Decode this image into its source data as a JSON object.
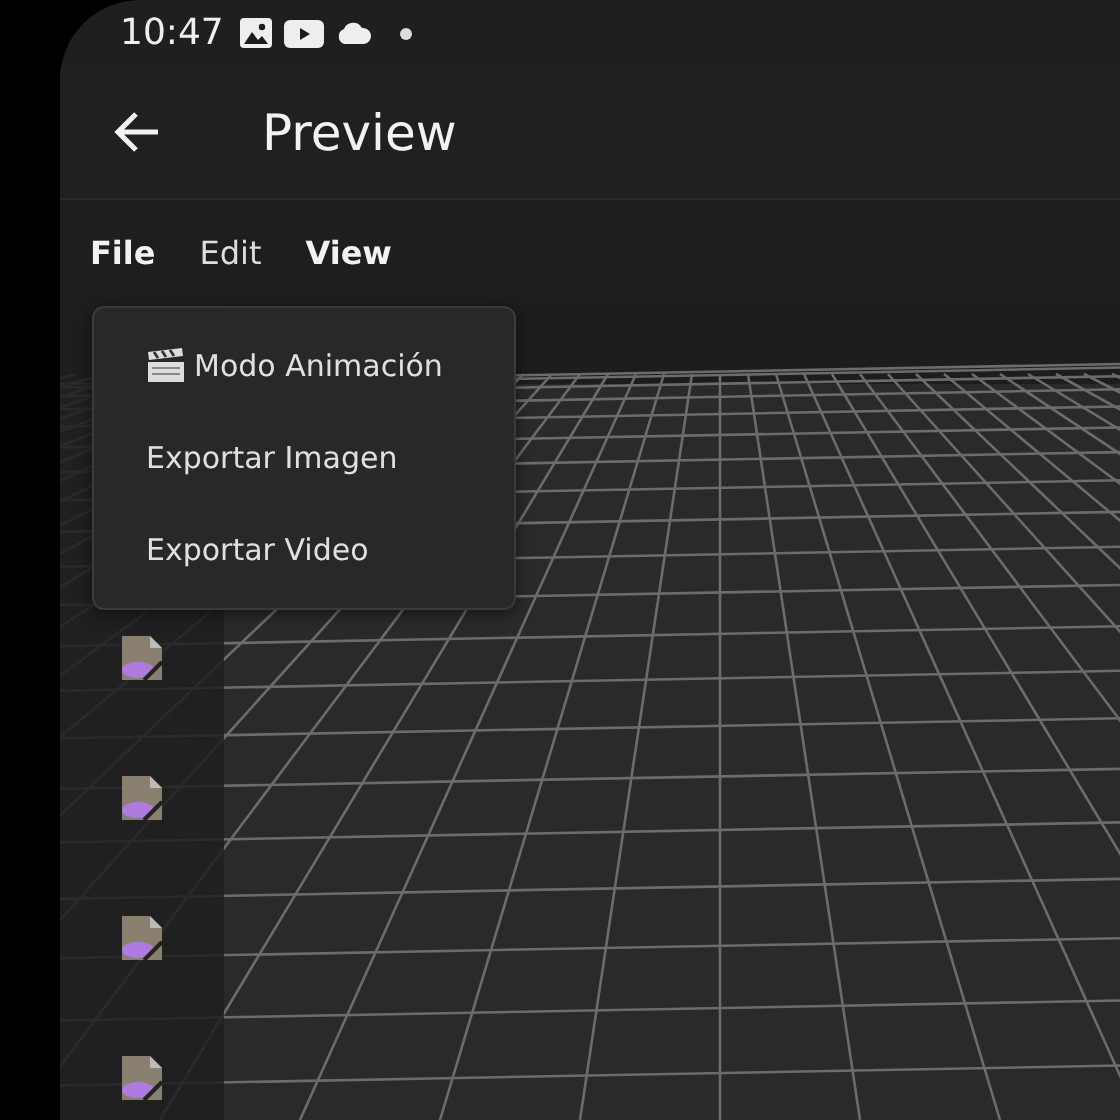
{
  "status_bar": {
    "time": "10:47"
  },
  "app_bar": {
    "title": "Preview"
  },
  "menu_bar": [
    {
      "label": "File",
      "selected": true
    },
    {
      "label": "Edit",
      "selected": false
    },
    {
      "label": "View",
      "selected": true
    }
  ],
  "dropdown": [
    {
      "label": "Modo Animación",
      "has_icon": true
    },
    {
      "label": "Exportar Imagen",
      "has_icon": false
    },
    {
      "label": "Exportar Video",
      "has_icon": false
    }
  ],
  "sidebar": {
    "items": [
      {
        "kind": "file"
      },
      {
        "kind": "file"
      },
      {
        "kind": "file"
      },
      {
        "kind": "file"
      }
    ]
  }
}
